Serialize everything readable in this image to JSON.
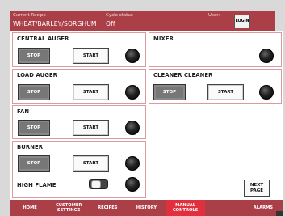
{
  "header": {
    "recipe_label": "Current Recipe",
    "recipe_value": "WHEAT/BARLEY/SORGHUM",
    "cycle_label": "Cycle status",
    "cycle_value": "Off",
    "user_label": "User:",
    "login_label": "LOGIN"
  },
  "panels": {
    "central_auger": {
      "title": "CENTRAL AUGER",
      "stop": "STOP",
      "start": "START"
    },
    "mixer": {
      "title": "MIXER"
    },
    "load_auger": {
      "title": "LOAD AUGER",
      "stop": "STOP",
      "start": "START"
    },
    "cleaner": {
      "title": "CLEANER   CLEANER",
      "stop": "STOP",
      "start": "START"
    },
    "fan": {
      "title": "FAN",
      "stop": "STOP",
      "start": "START"
    },
    "burner": {
      "title": "BURNER",
      "stop": "STOP",
      "start": "START",
      "high_flame_label": "HIGH FLAME"
    }
  },
  "next_page_label": "NEXT\nPAGE",
  "nav": {
    "tabs": [
      "HOME",
      "CUSTOMER\nSETTINGS",
      "RECIPES",
      "HISTORY",
      "MANUAL\nCONTROLS",
      "",
      "ALARMS"
    ],
    "active_index": 4
  },
  "colors": {
    "accent": "#ab3f48",
    "active_tab": "#e0303d"
  }
}
